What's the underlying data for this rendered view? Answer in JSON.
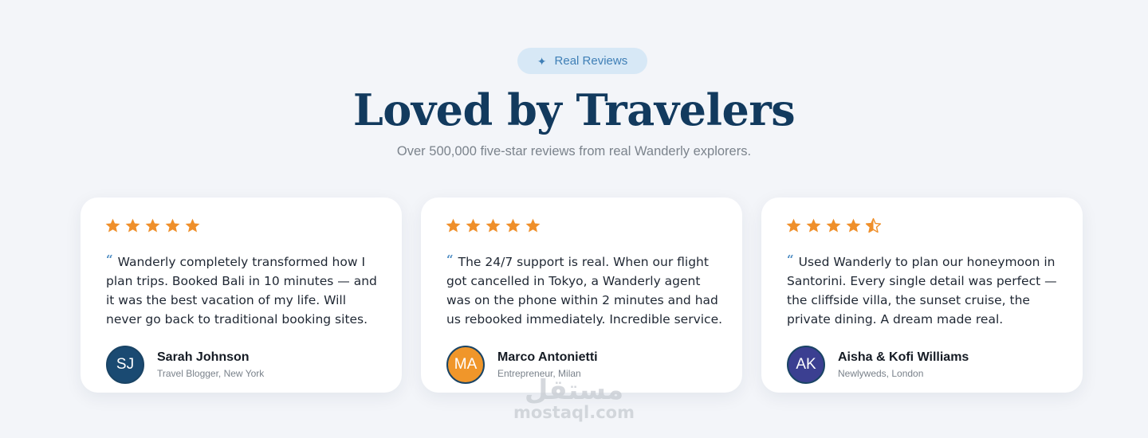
{
  "header": {
    "badge_icon": "sparkle-icon",
    "badge_label": "Real Reviews",
    "title": "Loved by Travelers",
    "subtitle": "Over 500,000 five-star reviews from real Wanderly explorers."
  },
  "colors": {
    "background": "#f3f5f9",
    "badge_bg": "#d7e8f6",
    "accent_blue": "#3f7fb6",
    "title": "#123a5e",
    "star": "#ef8f2a"
  },
  "reviews": [
    {
      "rating": 5,
      "quote": "Wanderly completely transformed how I plan trips. Booked Bali in 10 minutes — and it was the best vacation of my life. Will never go back to traditional booking sites.",
      "initials": "SJ",
      "avatar_color": "#1a4a72",
      "name": "Sarah Johnson",
      "role": "Travel Blogger, New York"
    },
    {
      "rating": 5,
      "quote": "The 24/7 support is real. When our flight got cancelled in Tokyo, a Wanderly agent was on the phone within 2 minutes and had us rebooked immediately. Incredible service.",
      "initials": "MA",
      "avatar_color": "#f0962a",
      "name": "Marco Antonietti",
      "role": "Entrepreneur, Milan"
    },
    {
      "rating": 4.5,
      "quote": "Used Wanderly to plan our honeymoon in Santorini. Every single detail was perfect — the cliffside villa, the sunset cruise, the private dining. A dream made real.",
      "initials": "AK",
      "avatar_color": "#3b3f91",
      "name": "Aisha & Kofi Williams",
      "role": "Newlyweds, London"
    }
  ],
  "watermark": {
    "logo": "مستقل",
    "text": "mostaql.com"
  }
}
